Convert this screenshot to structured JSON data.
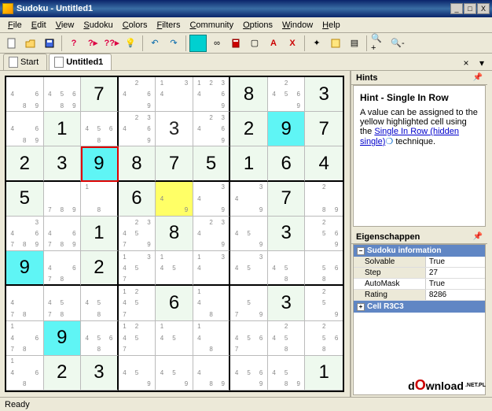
{
  "window": {
    "title": "Sudoku - Untitled1",
    "buttons": {
      "min": "_",
      "max": "□",
      "close": "X"
    }
  },
  "menu": [
    "File",
    "Edit",
    "View",
    "Sudoku",
    "Colors",
    "Filters",
    "Community",
    "Options",
    "Window",
    "Help"
  ],
  "tabs": [
    {
      "label": "Start",
      "active": false
    },
    {
      "label": "Untitled1",
      "active": true
    }
  ],
  "hints": {
    "title": "Hints",
    "heading": "Hint - Single In Row",
    "body_before": "A value can be assigned to the yellow highlighted cell using the ",
    "link": "Single In Row (hidden single)",
    "body_after": " technique."
  },
  "properties": {
    "title": "Eigenschappen",
    "group1": "Sudoku information",
    "rows": [
      {
        "k": "Solvable",
        "v": "True"
      },
      {
        "k": "Step",
        "v": "27"
      },
      {
        "k": "AutoMask",
        "v": "True"
      },
      {
        "k": "Rating",
        "v": "8286"
      }
    ],
    "group2": "Cell  R3C3"
  },
  "status": "Ready",
  "watermark": {
    "a": "d",
    "b": "O",
    "c": "wnload",
    "d": ".NET.PL"
  },
  "chart_data": {
    "type": "sudoku",
    "selected": [
      2,
      2
    ],
    "highlighted_yellow": [
      [
        3,
        4
      ]
    ],
    "highlighted_cyan": [
      [
        1,
        7
      ],
      [
        2,
        2
      ],
      [
        5,
        0
      ],
      [
        7,
        1
      ]
    ],
    "grid": [
      [
        {
          "c": [
            4,
            6,
            8,
            9
          ]
        },
        {
          "c": [
            4,
            5,
            6,
            8,
            9
          ]
        },
        {
          "v": 7,
          "g": 1
        },
        {
          "c": [
            2,
            4,
            6,
            9
          ]
        },
        {
          "c": [
            1,
            3,
            4
          ]
        },
        {
          "c": [
            1,
            2,
            3,
            4,
            6,
            9
          ]
        },
        {
          "v": 8,
          "g": 1
        },
        {
          "c": [
            2,
            4,
            5,
            6,
            9
          ]
        },
        {
          "v": 3,
          "g": 1
        }
      ],
      [
        {
          "c": [
            4,
            6,
            8,
            9
          ]
        },
        {
          "v": 1,
          "g": 1
        },
        {
          "c": [
            4,
            5,
            6,
            8
          ]
        },
        {
          "c": [
            2,
            3,
            4,
            6,
            9
          ]
        },
        {
          "v": 3,
          "g": 0,
          "c": [
            3,
            4,
            9
          ]
        },
        {
          "c": [
            2,
            3,
            4,
            6,
            9
          ]
        },
        {
          "v": 2,
          "g": 1
        },
        {
          "v": 9,
          "g": 1
        },
        {
          "v": 7,
          "g": 1
        }
      ],
      [
        {
          "v": 2,
          "g": 1
        },
        {
          "v": 3,
          "g": 1
        },
        {
          "v": 9,
          "g": 1
        },
        {
          "v": 8,
          "g": 1
        },
        {
          "v": 7,
          "g": 1
        },
        {
          "v": 5,
          "g": 1
        },
        {
          "v": 1,
          "g": 1
        },
        {
          "v": 6,
          "g": 1
        },
        {
          "v": 4,
          "g": 1
        }
      ],
      [
        {
          "v": 5,
          "g": 1
        },
        {
          "c": [
            7,
            8,
            9
          ]
        },
        {
          "c": [
            1,
            8
          ]
        },
        {
          "v": 6,
          "g": 1
        },
        {
          "c": [
            4,
            9
          ]
        },
        {
          "c": [
            3,
            4,
            9
          ]
        },
        {
          "c": [
            3,
            4,
            9
          ]
        },
        {
          "v": 7,
          "g": 1,
          "c": [
            2,
            4,
            7,
            9
          ]
        },
        {
          "c": [
            2,
            8,
            9
          ]
        }
      ],
      [
        {
          "c": [
            3,
            4,
            6,
            7,
            8,
            9
          ]
        },
        {
          "c": [
            4,
            6,
            7,
            8,
            9
          ]
        },
        {
          "v": 1,
          "g": 1
        },
        {
          "c": [
            2,
            3,
            4,
            5,
            7,
            9
          ]
        },
        {
          "v": 8,
          "g": 1
        },
        {
          "c": [
            2,
            3,
            4,
            9
          ]
        },
        {
          "c": [
            4,
            5,
            9
          ]
        },
        {
          "v": 3,
          "g": 1,
          "c": [
            2,
            4,
            5,
            9
          ]
        },
        {
          "c": [
            2,
            5,
            6,
            9
          ]
        }
      ],
      [
        {
          "v": 9,
          "g": 1
        },
        {
          "c": [
            4,
            6,
            7,
            8
          ]
        },
        {
          "v": 2,
          "g": 1
        },
        {
          "c": [
            1,
            3,
            4,
            5,
            7
          ]
        },
        {
          "c": [
            1,
            4,
            5
          ]
        },
        {
          "c": [
            1,
            3,
            4
          ]
        },
        {
          "c": [
            3,
            4,
            5
          ]
        },
        {
          "c": [
            4,
            5,
            8
          ]
        },
        {
          "c": [
            5,
            6,
            8
          ]
        }
      ],
      [
        {
          "c": [
            4,
            7,
            8
          ]
        },
        {
          "c": [
            4,
            5,
            7,
            8
          ]
        },
        {
          "c": [
            4,
            5,
            8
          ]
        },
        {
          "c": [
            1,
            2,
            4,
            5,
            7
          ]
        },
        {
          "v": 6,
          "g": 1
        },
        {
          "c": [
            1,
            4,
            8
          ]
        },
        {
          "c": [
            5,
            7,
            9
          ]
        },
        {
          "v": 3,
          "g": 1
        },
        {
          "c": [
            2,
            5,
            9
          ]
        }
      ],
      [
        {
          "c": [
            1,
            4,
            6,
            7,
            8
          ]
        },
        {
          "v": 9,
          "g": 1
        },
        {
          "c": [
            4,
            5,
            6,
            8
          ]
        },
        {
          "c": [
            1,
            2,
            4,
            5,
            7
          ]
        },
        {
          "c": [
            1,
            4,
            5
          ]
        },
        {
          "c": [
            1,
            4,
            8
          ]
        },
        {
          "c": [
            4,
            5,
            6,
            7
          ]
        },
        {
          "c": [
            2,
            4,
            5,
            8
          ]
        },
        {
          "c": [
            2,
            5,
            6,
            8
          ]
        }
      ],
      [
        {
          "c": [
            1,
            4,
            6,
            8
          ]
        },
        {
          "v": 2,
          "g": 1
        },
        {
          "v": 3,
          "g": 1
        },
        {
          "c": [
            4,
            5,
            9
          ]
        },
        {
          "c": [
            4,
            5,
            9
          ]
        },
        {
          "c": [
            4,
            8,
            9
          ]
        },
        {
          "c": [
            4,
            5,
            6,
            9
          ]
        },
        {
          "c": [
            4,
            5,
            8,
            9
          ]
        },
        {
          "v": 1,
          "g": 1
        }
      ]
    ]
  }
}
